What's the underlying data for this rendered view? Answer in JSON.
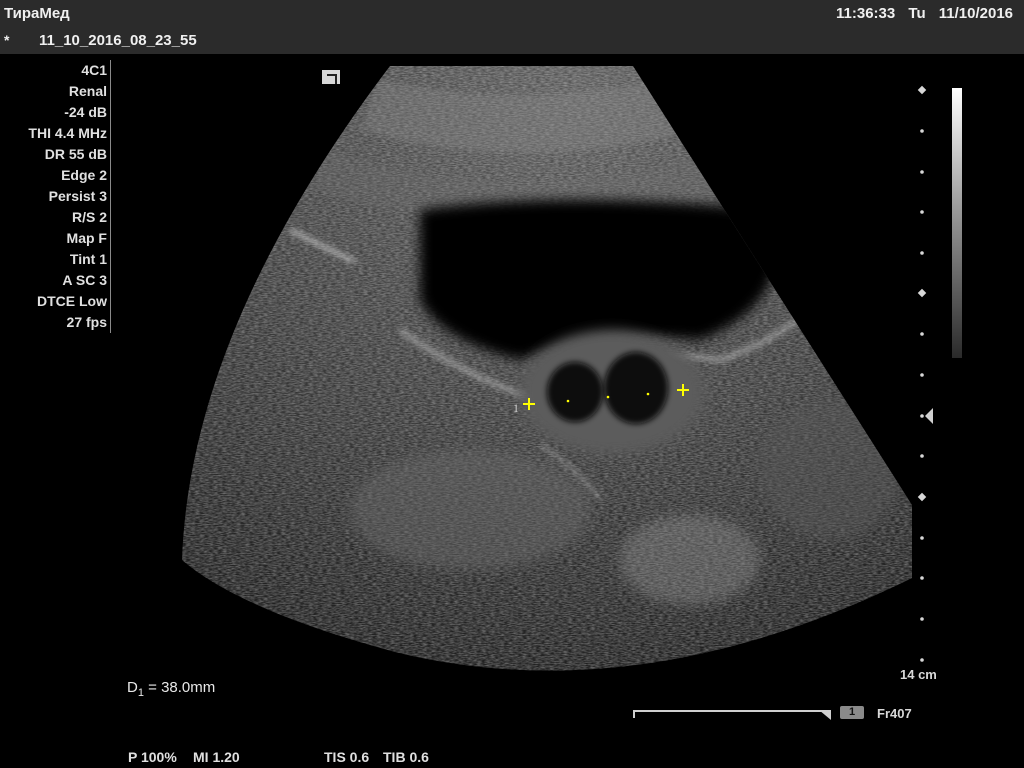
{
  "header": {
    "brand": "ТираМед",
    "file_marker": "*",
    "file_name": "11_10_2016_08_23_55",
    "time": "11:36:33",
    "weekday": "Tu",
    "date": "11/10/2016"
  },
  "params": [
    "4C1",
    "Renal",
    "-24 dB",
    "THI 4.4 MHz",
    "DR 55 dB",
    "Edge 2",
    "Persist 3",
    "R/S 2",
    "Map F",
    "Tint 1",
    "A SC 3",
    "DTCE Low",
    "27 fps"
  ],
  "measurement": {
    "marker_label": "1",
    "label": "D",
    "index": "1",
    "value": " = 38.0mm"
  },
  "scale": {
    "unit": "14 cm"
  },
  "cine": {
    "badge": "1",
    "frame": "Fr407"
  },
  "footer": {
    "power": "P 100%",
    "mi": "MI 1.20",
    "tis": "TIS 0.6",
    "tib": "TIB 0.6"
  },
  "colors": {
    "header_bg": "#2b2b2b",
    "caliper": "#ffff00",
    "text": "#e8e8e8"
  }
}
